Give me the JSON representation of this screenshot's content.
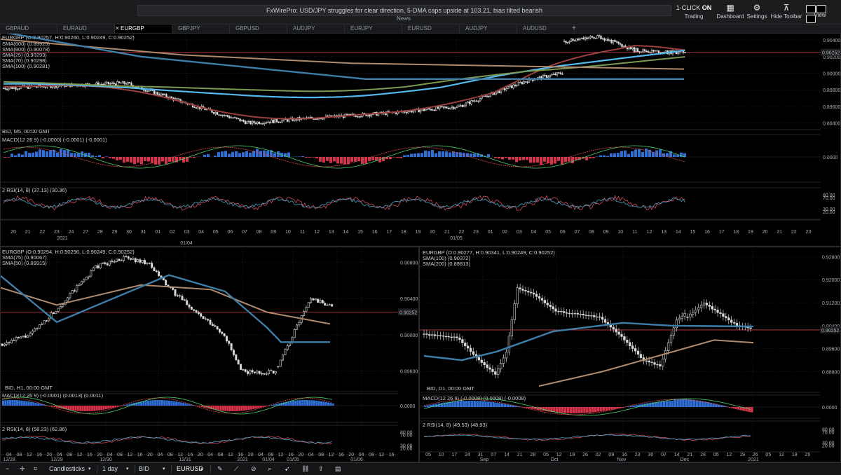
{
  "topbar": {
    "news_text": "FxWirePro: USD/JPY struggles for clear direction, 5-DMA caps upside at 103.21, bias tilted bearish",
    "news_label": "News",
    "oneclick_prefix": "1-CLICK",
    "oneclick_state": "ON",
    "trading_label": "Trading",
    "dashboard_label": "Dashboard",
    "settings_label": "Settings",
    "hide_toolbar_label": "Hide Toolbar",
    "view_label": "View",
    "icons": {
      "dashboard": "grid-icon",
      "settings": "gear-icon",
      "hide_toolbar": "collapse-icon",
      "view": "layout-icon"
    }
  },
  "tabs": [
    {
      "label": "GBPAUD",
      "active": false
    },
    {
      "label": "EURAUD",
      "active": false
    },
    {
      "label": "EURGBP",
      "active": true
    },
    {
      "label": "GBPJPY",
      "active": false
    },
    {
      "label": "GBPUSD",
      "active": false
    },
    {
      "label": "AUDJPY",
      "active": false
    },
    {
      "label": "EURJPY",
      "active": false
    },
    {
      "label": "EURUSD",
      "active": false
    },
    {
      "label": "AUDJPY",
      "active": false
    },
    {
      "label": "AUDUSD",
      "active": false
    }
  ],
  "tab_add": "+",
  "tab_close": "✕",
  "colors": {
    "bg": "#000000",
    "grid": "#2f3033",
    "candle": "#d8d8d8",
    "sma_light_blue": "#55b8ee",
    "sma_blue": "#3f7ea8",
    "sma_tan": "#b08a6c",
    "sma_green": "#7b9a52",
    "sma_red": "#9c3f3f",
    "price_line": "#c8404a",
    "macd_pos": "#2f6fd6",
    "macd_neg": "#d6324a",
    "rsi_a": "#d14b5a",
    "rsi_b": "#4aa6c8"
  },
  "panel_top": {
    "header": "EURGBP (O:0.90257, H:0.90260, L:0.90249, C:0.90252)",
    "legend": [
      "SMA(600) (0.89925)",
      "SMA(900) (0.90078)",
      "SMA(25) (0.90293)",
      "SMA(70) (0.90298)",
      "SMA(100) (0.90281)"
    ],
    "footer": "BID, M5, 00:00 GMT",
    "macd_label": "MACD(12 26 9) (-0.0000) (-0.0001) (-0.0001)",
    "rsi_label": "2 RSI(14, 8) (37.13) (30.36)",
    "price_ticks": [
      "0.90400",
      "0.90200",
      "0.90000",
      "0.89800",
      "0.89600",
      "0.89400"
    ],
    "price_tag": "0.90252",
    "price_tag_2": "0.90200",
    "macd_zero": "0.0000",
    "rsi_ticks": [
      "80.00",
      "70.00",
      "30.00",
      "20.00"
    ],
    "x_ticks": [
      "20",
      "21",
      "22",
      "23",
      "24",
      "27",
      "28",
      "29",
      "30",
      "31",
      "01",
      "02",
      "03",
      "04",
      "05",
      "06",
      "07",
      "08",
      "09",
      "10",
      "11",
      "12",
      "13",
      "14",
      "15",
      "16",
      "17",
      "18",
      "19",
      "20",
      "21",
      "22",
      "23",
      "01",
      "02",
      "03",
      "04",
      "05",
      "06",
      "07",
      "08",
      "09",
      "10",
      "11",
      "12",
      "13",
      "14",
      "15",
      "16",
      "17",
      "18",
      "19",
      "20",
      "21",
      "22",
      "23"
    ],
    "x_sub": [
      {
        "label": "2021",
        "under": "28"
      },
      {
        "label": "01/04",
        "under": "07"
      },
      {
        "label": "01/05",
        "under": "23b"
      }
    ]
  },
  "panel_bl": {
    "header": "EURGBP (O:0.90294, H:0.90296, L:0.90249, C:0.90252)",
    "legend": [
      "SMA(75) (0.90067)",
      "SMA(50) (0.89915)"
    ],
    "footer": "BID, H1, 00:00 GMT",
    "macd_label": "MACD(12 26 9) (-0.0001) (0.0013) (0.0011)",
    "rsi_label": "2 RSI(14, 8) (58.23) (62.86)",
    "price_ticks": [
      "0.90800",
      "0.90400",
      "0.90000",
      "0.89600"
    ],
    "price_tag": "0.90252",
    "macd_zero": "0.0000",
    "rsi_ticks": [
      "80.00",
      "70.00",
      "30.00",
      "20.00"
    ],
    "x_ticks": [
      "04",
      "08",
      "12",
      "16",
      "20",
      "04",
      "08",
      "12",
      "16",
      "20",
      "04",
      "08",
      "12",
      "16",
      "20",
      "04",
      "08",
      "12",
      "16",
      "20",
      "04",
      "08",
      "12",
      "16",
      "20",
      "04",
      "08",
      "12",
      "16",
      "20",
      "04",
      "08",
      "12",
      "16",
      "20",
      "04",
      "08",
      "12",
      "16"
    ],
    "x_sub": [
      "12/28",
      "12/29",
      "12/30",
      "12/31",
      "2021",
      "01/04",
      "01/05",
      "01/06"
    ]
  },
  "panel_br": {
    "header": "EURGBP (O:0.90277, H:0.90341, L:0.90249, C:0.90252)",
    "legend": [
      "SMA(100) (0.90372)",
      "SMA(200) (0.89813)"
    ],
    "footer": "BID, D1, 00:00 GMT",
    "macd_label": "MACD(12 26 9) (-0.0008) (0.0008) (-0.0008)",
    "rsi_label": "2 RSI(14, 8) (49.53) (48.93)",
    "price_ticks": [
      "0.92800",
      "0.92000",
      "0.91200",
      "0.90400",
      "0.89600",
      "0.88800"
    ],
    "price_tag": "0.90252",
    "macd_zero": "0.0000",
    "rsi_ticks": [
      "80.00",
      "70.00",
      "30.00",
      "20.00"
    ],
    "x_ticks": [
      "05",
      "10",
      "17",
      "24",
      "31",
      "07",
      "14",
      "21",
      "28",
      "05",
      "12",
      "19",
      "26",
      "02",
      "09",
      "16",
      "23",
      "30",
      "07",
      "14",
      "21",
      "28",
      "05",
      "12",
      "19",
      "26",
      "05",
      "12",
      "19",
      "25"
    ],
    "x_sub": [
      "Sep",
      "Oct",
      "Nov",
      "Dec",
      "2021"
    ]
  },
  "bottombar": {
    "chart_type": "Candlesticks",
    "period": "1 day",
    "price_side": "BID",
    "instrument": "EURUSD",
    "icons": [
      "minus-icon",
      "crosshair-icon",
      "crop-icon",
      "chevron-down-icon",
      "chevron-down-icon",
      "chevron-down-icon",
      "chevron-up-icon",
      "pencil-icon",
      "chart-icon",
      "indicator-hide-icon",
      "zoom-icon",
      "pointer-icon",
      "link-icon",
      "share-icon",
      "layers-icon"
    ]
  }
}
